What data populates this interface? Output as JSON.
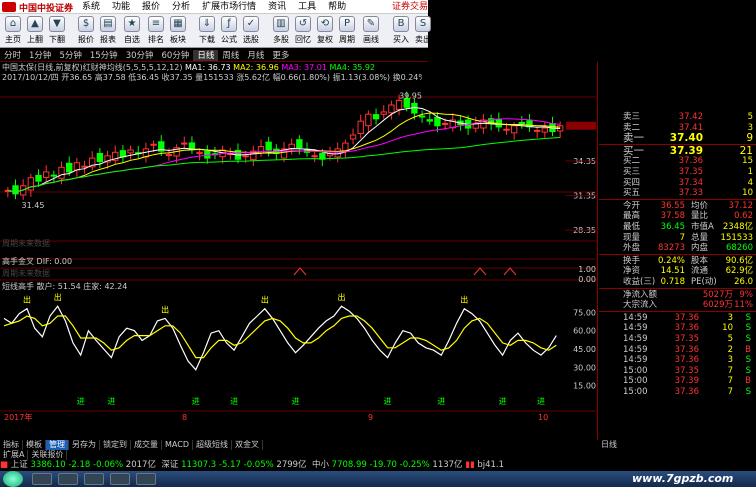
{
  "app": {
    "logo_text": "中国中投证券",
    "trade_link": "证券交易"
  },
  "menu": [
    "系统",
    "功能",
    "报价",
    "分析",
    "扩展市场行情",
    "资讯",
    "工具",
    "帮助"
  ],
  "toolbar": [
    {
      "icon": "home-icon",
      "label": "主页",
      "glyph": "⌂"
    },
    {
      "icon": "up-icon",
      "label": "上翻",
      "glyph": "▲"
    },
    {
      "icon": "down-icon",
      "label": "下翻",
      "glyph": "▼"
    },
    {
      "icon": "price-icon",
      "label": "报价",
      "glyph": "$"
    },
    {
      "icon": "report-icon",
      "label": "报表",
      "glyph": "▤"
    },
    {
      "icon": "watchlist-icon",
      "label": "自选",
      "glyph": "★"
    },
    {
      "icon": "ranking-icon",
      "label": "排名",
      "glyph": "≡"
    },
    {
      "icon": "sector-icon",
      "label": "板块",
      "glyph": "▦"
    },
    {
      "icon": "order-icon",
      "label": "下载",
      "glyph": "⇓"
    },
    {
      "icon": "formula-icon",
      "label": "公式",
      "glyph": "ƒ"
    },
    {
      "icon": "select-stock-icon",
      "label": "选股",
      "glyph": "✓"
    },
    {
      "icon": "multi-icon",
      "label": "多股",
      "glyph": "▥"
    },
    {
      "icon": "replay-icon",
      "label": "回忆",
      "glyph": "↺"
    },
    {
      "icon": "restore-icon",
      "label": "复权",
      "glyph": "⟲"
    },
    {
      "icon": "period-icon",
      "label": "周期",
      "glyph": "P"
    },
    {
      "icon": "draw-icon",
      "label": "画线",
      "glyph": "✎"
    },
    {
      "icon": "buy-icon",
      "label": "买入",
      "glyph": "B"
    },
    {
      "icon": "sell-icon",
      "label": "卖出",
      "glyph": "S"
    }
  ],
  "periods": [
    "分时",
    "1分钟",
    "5分钟",
    "15分钟",
    "30分钟",
    "60分钟",
    "日线",
    "周线",
    "月线",
    "更多"
  ],
  "active_period": "日线",
  "chart_header": {
    "title_line": "中国太保(日线,前复权)红财神均线(5,5,5,5,12,12)",
    "ma1": "MA1: 36.73",
    "ma2": "MA2: 36.96",
    "ma3": "MA3: 37.01",
    "ma4": "MA4: 35.92",
    "bar_info": "2017/10/12/四 开36.65 高37.58 低36.45 收37.35 量151533 涨5.62亿 幅0.66(1.80%) 振1.13(3.08%) 换0.24% 流通62.9亿 仲险",
    "price_high_label": "39.95",
    "price_low_label": "31.45",
    "y_labels": [
      "37.35",
      "34.35",
      "31.35",
      "28.35"
    ],
    "note": "周期未来数据"
  },
  "sub1": {
    "title": "高手金叉  DIF: 0.00",
    "note": "周期未来数据",
    "y_labels": [
      "1.00",
      "0.00"
    ]
  },
  "sub2": {
    "title": "短线高手  散户: 51.54  庄家: 42.24",
    "y_labels": [
      "75.00",
      "60.00",
      "45.00",
      "30.00",
      "15.00"
    ],
    "out_label": "出",
    "in_label": "进"
  },
  "x_labels": [
    "2017年",
    "8",
    "9",
    "10"
  ],
  "quote_panel": {
    "sells": [
      {
        "label": "卖三",
        "price": "37.42",
        "vol": "5"
      },
      {
        "label": "卖二",
        "price": "37.41",
        "vol": "3"
      },
      {
        "label": "卖一",
        "price": "37.40",
        "vol": "9"
      }
    ],
    "buys": [
      {
        "label": "买一",
        "price": "37.39",
        "vol": "21"
      },
      {
        "label": "买二",
        "price": "37.36",
        "vol": "15"
      },
      {
        "label": "买三",
        "price": "37.35",
        "vol": "1"
      },
      {
        "label": "买四",
        "price": "37.34",
        "vol": "4"
      },
      {
        "label": "买五",
        "price": "37.33",
        "vol": "10"
      }
    ],
    "stats": [
      {
        "k1": "今开",
        "v1": "36.55",
        "k2": "均价",
        "v2": "37.12"
      },
      {
        "k1": "最高",
        "v1": "37.58",
        "k2": "量比",
        "v2": "0.62"
      },
      {
        "k1": "最低",
        "v1": "36.45",
        "k2": "市值A",
        "v2": "2348亿"
      },
      {
        "k1": "现量",
        "v1": "7",
        "k2": "总量",
        "v2": "151533"
      },
      {
        "k1": "外盘",
        "v1": "83273",
        "k2": "内盘",
        "v2": "68260"
      }
    ],
    "stats2": [
      {
        "k1": "换手",
        "v1": "0.24%",
        "k2": "股本",
        "v2": "90.6亿"
      },
      {
        "k1": "净资",
        "v1": "14.51",
        "k2": "流通",
        "v2": "62.9亿"
      },
      {
        "k1": "收益(三)",
        "v1": "0.718",
        "k2": "PE(动)",
        "v2": "26.0"
      }
    ],
    "flows": [
      {
        "k": "净流入额",
        "v": "5027万",
        "p": "9%"
      },
      {
        "k": "大宗流入",
        "v": "6029万",
        "p": "11%"
      }
    ],
    "ticks": [
      {
        "t": "14:59",
        "p": "37.36",
        "v": "3",
        "s": "S"
      },
      {
        "t": "14:59",
        "p": "37.36",
        "v": "10",
        "s": "S"
      },
      {
        "t": "14:59",
        "p": "37.35",
        "v": "5",
        "s": "S"
      },
      {
        "t": "14:59",
        "p": "37.36",
        "v": "2",
        "s": "B"
      },
      {
        "t": "14:59",
        "p": "37.36",
        "v": "3",
        "s": "S"
      },
      {
        "t": "15:00",
        "p": "37.35",
        "v": "7",
        "s": "S"
      },
      {
        "t": "15:00",
        "p": "37.39",
        "v": "7",
        "s": "B"
      },
      {
        "t": "15:00",
        "p": "37.36",
        "v": "7",
        "s": "S"
      }
    ],
    "current_price": "37.40",
    "tabs_bottom": "日线"
  },
  "bottom_tabs": [
    "指标",
    "模板",
    "管理",
    "另存为",
    "锁定到",
    "成交量",
    "MACD",
    "超级短线",
    "双金叉"
  ],
  "active_bottom_tab": "管理",
  "bottom_tabs2": [
    "扩展A",
    "关联报价"
  ],
  "status": {
    "sh_label": "上证",
    "sh_val": "3386.10",
    "sh_chg": "-2.18",
    "sh_pct": "-0.06%",
    "sh_amt": "2017亿",
    "sz_label": "深证",
    "sz_val": "11307.3",
    "sz_chg": "-5.17",
    "sz_pct": "-0.05%",
    "sz_amt": "2799亿",
    "zx_label": "中小",
    "zx_val": "7708.99",
    "zx_chg": "-19.70",
    "zx_pct": "-0.25%",
    "zx_amt": "1137亿",
    "server": "bj41.1"
  },
  "watermark": "www.7gpzb.com",
  "chart_data": {
    "type": "line",
    "title": "",
    "x": [
      "2017年",
      "8",
      "9",
      "10"
    ],
    "price_range": [
      27.5,
      40.5
    ],
    "candles_close": [
      31.8,
      31.5,
      32.2,
      32.9,
      32.6,
      33.4,
      33.1,
      33.8,
      33.4,
      34.2,
      33.9,
      34.6,
      34.3,
      34.8,
      35.1,
      34.7,
      35.3,
      35.0,
      35.4,
      35.8,
      35.2,
      34.9,
      35.5,
      35.9,
      35.4,
      35.1,
      34.6,
      34.9,
      35.3,
      35.0,
      34.5,
      34.8,
      35.2,
      35.6,
      35.3,
      35.0,
      35.4,
      35.8,
      35.5,
      35.1,
      34.8,
      34.5,
      35.0,
      35.4,
      35.9,
      36.6,
      37.8,
      38.4,
      38.0,
      38.6,
      39.2,
      39.6,
      39.0,
      38.5,
      38.2,
      37.8,
      37.4,
      37.6,
      37.9,
      37.5,
      37.2,
      37.6,
      37.9,
      37.6,
      37.3,
      37.1,
      37.4,
      37.6,
      37.3,
      37.0,
      37.2,
      36.9,
      37.4
    ],
    "kdj_white": [
      70,
      66,
      74,
      78,
      62,
      55,
      72,
      80,
      68,
      50,
      40,
      60,
      52,
      45,
      38,
      55,
      62,
      60,
      52,
      56,
      68,
      70,
      62,
      48,
      35,
      28,
      42,
      58,
      60,
      50,
      44,
      55,
      66,
      72,
      78,
      70,
      60,
      50,
      42,
      48,
      55,
      62,
      68,
      72,
      80,
      76,
      70,
      62,
      52,
      44,
      38,
      50,
      60,
      58,
      50,
      46,
      44,
      40,
      52,
      66,
      78,
      74,
      68,
      58,
      48,
      40,
      52,
      58,
      50,
      44,
      40,
      46,
      56
    ],
    "kdj_yellow": [
      64,
      66,
      68,
      72,
      70,
      64,
      66,
      72,
      72,
      64,
      54,
      54,
      54,
      50,
      44,
      46,
      52,
      56,
      56,
      56,
      60,
      64,
      64,
      58,
      48,
      38,
      38,
      46,
      52,
      52,
      48,
      50,
      56,
      62,
      68,
      70,
      68,
      62,
      54,
      50,
      50,
      54,
      60,
      64,
      70,
      72,
      72,
      68,
      62,
      54,
      46,
      46,
      50,
      54,
      54,
      52,
      48,
      44,
      46,
      52,
      62,
      68,
      70,
      66,
      58,
      50,
      48,
      52,
      52,
      50,
      46,
      44,
      48
    ]
  }
}
